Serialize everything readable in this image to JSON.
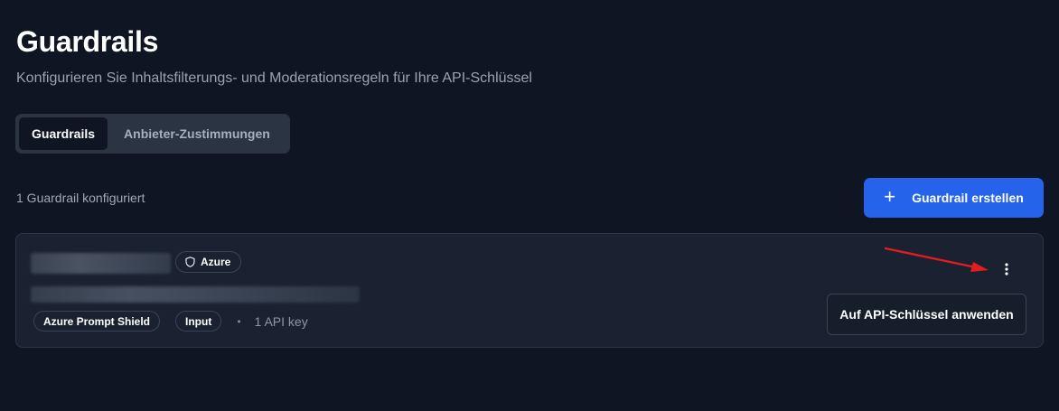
{
  "header": {
    "title": "Guardrails",
    "subtitle": "Konfigurieren Sie Inhaltsfilterungs- und Moderationsregeln für Ihre API-Schlüssel"
  },
  "tabs": [
    {
      "label": "Guardrails",
      "active": true
    },
    {
      "label": "Anbieter-Zustimmungen",
      "active": false
    }
  ],
  "toolbar": {
    "count_text": "1 Guardrail konfiguriert",
    "create_label": "Guardrail erstellen",
    "create_icon": "plus-icon"
  },
  "guardrails": [
    {
      "name": "",
      "description": "",
      "provider": "Azure",
      "provider_icon": "shield-icon",
      "type": "Azure Prompt Shield",
      "direction": "Input",
      "separator": "•",
      "api_key_count": "1 API key",
      "menu_icon": "more-vertical-icon",
      "apply_label": "Auf API-Schlüssel anwenden"
    }
  ],
  "annotation": {
    "type": "arrow",
    "color": "#e11d1d",
    "target": "more-vertical-icon"
  },
  "colors": {
    "background": "#0f1523",
    "card": "#1a2231",
    "accent": "#2563eb",
    "text_primary": "#ffffff",
    "text_muted": "#9aa3b2"
  }
}
